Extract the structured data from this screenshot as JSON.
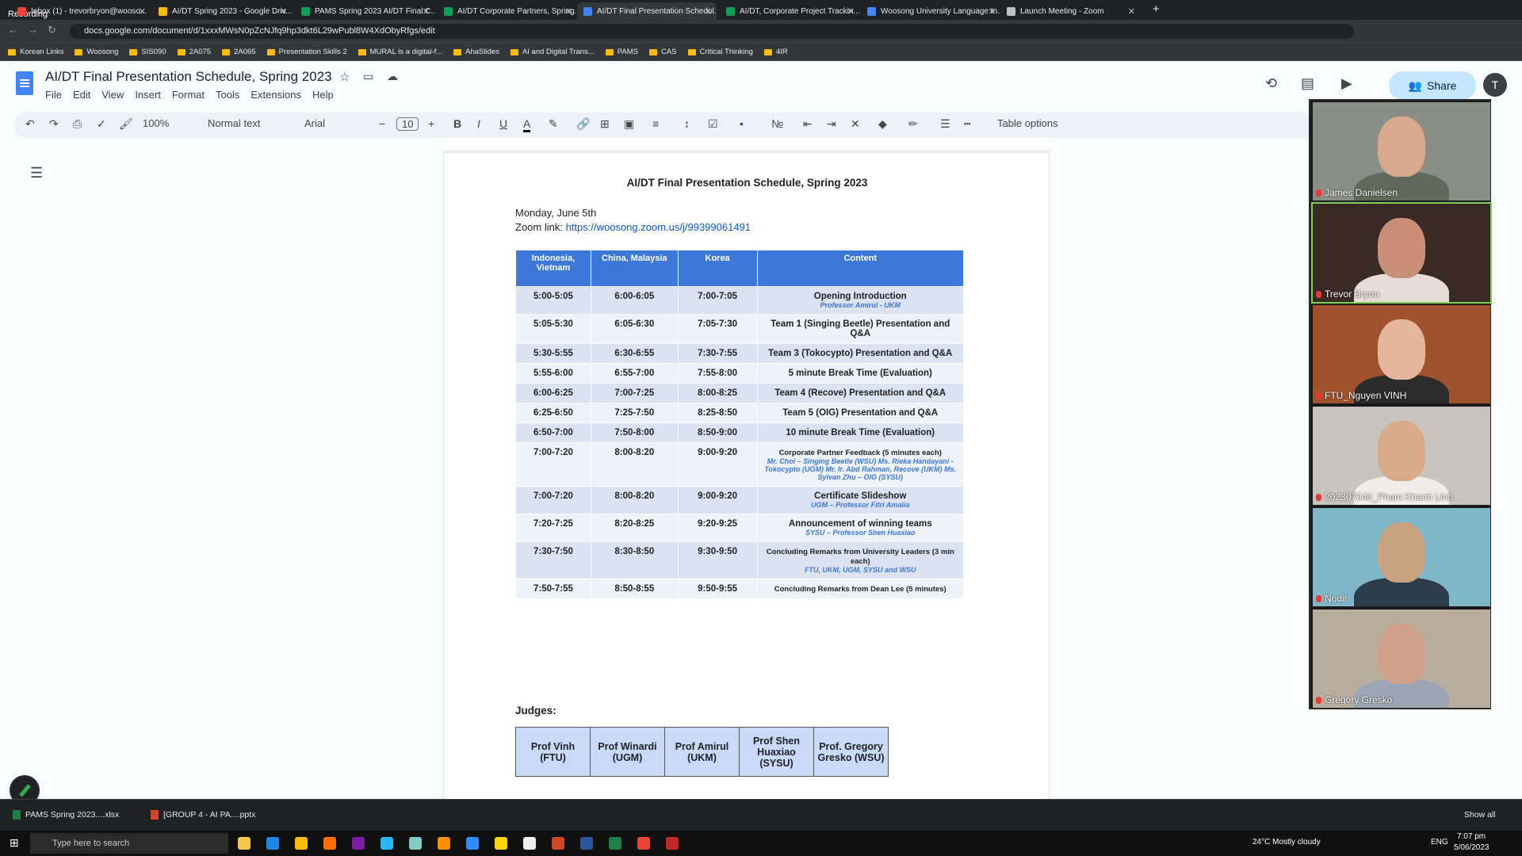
{
  "browser": {
    "recording_label": "Recording",
    "tabs": [
      {
        "title": "Inbox (1) - trevorbryon@wooso...",
        "color": "#ea4335"
      },
      {
        "title": "AI/DT Spring 2023 - Google Driv...",
        "color": "#fbbc04"
      },
      {
        "title": "PAMS Spring 2023 AI/DT Final C...",
        "color": "#0f9d58"
      },
      {
        "title": "AI/DT Corporate Partners, Spring...",
        "color": "#0f9d58"
      },
      {
        "title": "AI/DT Final Presentation Schedul...",
        "color": "#4285f4"
      },
      {
        "title": "AI/DT, Corporate Project Trackin...",
        "color": "#0f9d58"
      },
      {
        "title": "Woosong University Language In...",
        "color": "#4285f4"
      },
      {
        "title": "Launch Meeting - Zoom",
        "color": "#bdc1c6"
      }
    ],
    "url": "docs.google.com/document/d/1xxxMWsN0pZcNJfq9hp3dkt6L29wPubl8W4XdObyRfgs/edit",
    "bookmarks": [
      "Korean Links",
      "Woosong",
      "SIS090",
      "2A075",
      "2A065",
      "Presentation Skills 2",
      "MURAL is a digital-f...",
      "AhaSlides",
      "AI and Digital Trans...",
      "PAMS",
      "CAS",
      "Critical Thinking",
      "4IR"
    ]
  },
  "docs": {
    "title": "AI/DT Final Presentation Schedule, Spring 2023",
    "menus": [
      "File",
      "Edit",
      "View",
      "Insert",
      "Format",
      "Tools",
      "Extensions",
      "Help"
    ],
    "zoom": "100%",
    "style": "Normal text",
    "font": "Arial",
    "font_size": "10",
    "table_options": "Table options",
    "share": "Share",
    "avatar": "T"
  },
  "document": {
    "heading": "AI/DT Final Presentation Schedule, Spring 2023",
    "date": "Monday, June 5th",
    "zoom_label": "Zoom link: ",
    "zoom_link": "https://woosong.zoom.us/j/99399061491",
    "headers": [
      "Indonesia, Vietnam",
      "China, Malaysia",
      "Korea",
      "Content"
    ],
    "rows": [
      {
        "a": "5:00-5:05",
        "b": "6:00-6:05",
        "c": "7:00-7:05",
        "content": "Opening Introduction",
        "note": "Professor Amirul - UKM"
      },
      {
        "a": "5:05-5:30",
        "b": "6:05-6:30",
        "c": "7:05-7:30",
        "content": "Team 1 (Singing Beetle) Presentation and Q&A",
        "note": ""
      },
      {
        "a": "5:30-5:55",
        "b": "6:30-6:55",
        "c": "7:30-7:55",
        "content": "Team 3 (Tokocypto) Presentation and Q&A",
        "note": ""
      },
      {
        "a": "5:55-6:00",
        "b": "6:55-7:00",
        "c": "7:55-8:00",
        "content": "5 minute Break Time (Evaluation)",
        "note": ""
      },
      {
        "a": "6:00-6:25",
        "b": "7:00-7:25",
        "c": "8:00-8:25",
        "content": "Team 4 (Recove) Presentation and Q&A",
        "note": ""
      },
      {
        "a": "6:25-6:50",
        "b": "7:25-7:50",
        "c": "8:25-8:50",
        "content": "Team 5 (OIG) Presentation and Q&A",
        "note": ""
      },
      {
        "a": "6:50-7:00",
        "b": "7:50-8:00",
        "c": "8:50-9:00",
        "content": "10 minute Break Time (Evaluation)",
        "note": ""
      },
      {
        "a": "7:00-7:20",
        "b": "8:00-8:20",
        "c": "9:00-9:20",
        "content": "Corporate Partner Feedback (5 minutes each)",
        "note": "Mr. Choi – Singing Beetle (WSU) Ms. Rieka Handayani - Tokocypto (UGM) Mr. Ir. Abd Rahman, Recove (UKM) Ms. Sylvan Zhu – OIG (SYSU)",
        "small": true
      },
      {
        "a": "7:00-7:20",
        "b": "8:00-8:20",
        "c": "9:00-9:20",
        "content": "Certificate Slideshow",
        "note": "UGM – Professor Fitri Amalia"
      },
      {
        "a": "7:20-7:25",
        "b": "8:20-8:25",
        "c": "9:20-9:25",
        "content": "Announcement of winning teams",
        "note": "SYSU – Professor Shen Huaxiao"
      },
      {
        "a": "7:30-7:50",
        "b": "8:30-8:50",
        "c": "9:30-9:50",
        "content": "Concluding Remarks from University Leaders (3 min each)",
        "note": "FTU, UKM, UGM, SYSU and WSU",
        "small": true
      },
      {
        "a": "7:50-7:55",
        "b": "8:50-8:55",
        "c": "9:50-9:55",
        "content": "Concluding Remarks from Dean Lee (5 minutes)",
        "note": "",
        "small": true
      }
    ],
    "judges_label": "Judges:",
    "judges": [
      "Prof Vinh (FTU)",
      "Prof Winardi (UGM)",
      "Prof Amirul (UKM)",
      "Prof Shen Huaxiao (SYSU)",
      "Prof. Gregory Gresko (WSU)"
    ]
  },
  "zoom_participants": [
    {
      "name": "James Danielsen",
      "bg": "#8a8f86",
      "skin": "#d8a98f",
      "shirt": "#5f6a5b"
    },
    {
      "name": "Trevor Bryon",
      "bg": "#3a2a24",
      "skin": "#c98f78",
      "shirt": "#e8dcd8"
    },
    {
      "name": "FTU_Nguyen  VINH",
      "bg": "#a0522d",
      "skin": "#e6b69c",
      "shirt": "#2b2b2b"
    },
    {
      "name": "202307040_Pham Khanh Linh",
      "bg": "#c9c4bd",
      "skin": "#d9a988",
      "shirt": "#f1ece6"
    },
    {
      "name": "Nodir",
      "bg": "#7fb7c9",
      "skin": "#c9a483",
      "shirt": "#2f3d48"
    },
    {
      "name": "Gregory Gresko",
      "bg": "#b9ae9d",
      "skin": "#d1a08a",
      "shirt": "#9aa6b3"
    }
  ],
  "downloads": [
    "PAMS Spring 2023....xlsx",
    "[GROUP 4 - AI PA....pptx"
  ],
  "downloads_show_all": "Show all",
  "taskbar": {
    "search": "Type here to search",
    "weather": "24°C  Mostly cloudy",
    "lang": "ENG",
    "time": "7:07 pm",
    "date": "5/06/2023"
  }
}
